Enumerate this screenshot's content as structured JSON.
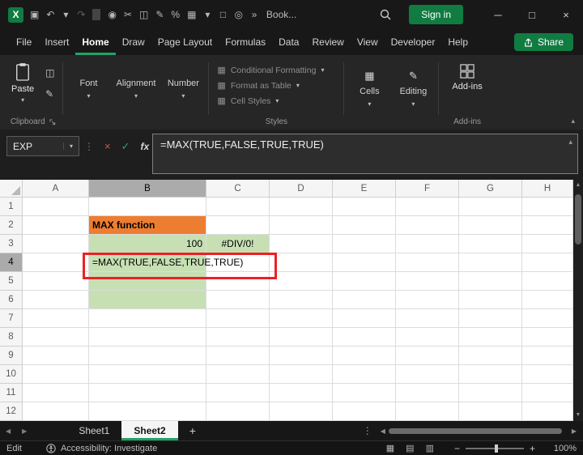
{
  "colors": {
    "excel-green": "#107C41",
    "accent-green": "#21A366",
    "cell-orange": "#ED7D31",
    "cell-green": "#C6E0B4",
    "annotation-red": "#ED2024"
  },
  "icons": {
    "caret": "▾",
    "collapse": "▴",
    "expand": "▴",
    "minimize": "─",
    "maximize": "□",
    "close": "×",
    "copy": "◫",
    "format_painter": "✎",
    "cells": "▦",
    "editing": "✎",
    "dots": "⋮",
    "cancel": "×",
    "check": "✓",
    "tri_up": "▲",
    "tri_down": "▼",
    "tri_left": "◀",
    "tri_right": "▶",
    "plus": "+",
    "minus": "−"
  },
  "titlebar": {
    "logo_letter": "X",
    "title": "Book...",
    "sign_in_label": "Sign in",
    "qat_icons": [
      {
        "name": "save",
        "glyph": "▣"
      },
      {
        "name": "undo",
        "glyph": "↶"
      },
      {
        "name": "undo-caret",
        "glyph": "▾"
      },
      {
        "name": "redo",
        "glyph": "↷",
        "dim": true
      },
      {
        "name": "separator",
        "glyph": "",
        "divider": true
      },
      {
        "name": "touch-mode",
        "glyph": "◉"
      },
      {
        "name": "cut",
        "glyph": "✂"
      },
      {
        "name": "copy",
        "glyph": "◫"
      },
      {
        "name": "format-painter",
        "glyph": "✎"
      },
      {
        "name": "percent-style",
        "glyph": "%"
      },
      {
        "name": "borders",
        "glyph": "▦"
      },
      {
        "name": "dropdown-caret",
        "glyph": "▾"
      },
      {
        "name": "new-document",
        "glyph": "□"
      },
      {
        "name": "camera",
        "glyph": "◎"
      },
      {
        "name": "more-commands",
        "glyph": "»"
      }
    ]
  },
  "menu": {
    "items": [
      "File",
      "Insert",
      "Home",
      "Draw",
      "Page Layout",
      "Formulas",
      "Data",
      "Review",
      "View",
      "Developer",
      "Help"
    ],
    "active": "Home",
    "share_label": "Share"
  },
  "ribbon": {
    "paste_label": "Paste",
    "collapsed_groups": [
      "Font",
      "Alignment",
      "Number"
    ],
    "styles_buttons": [
      {
        "label": "Conditional Formatting",
        "glyph": "▦"
      },
      {
        "label": "Format as Table",
        "glyph": "▦"
      },
      {
        "label": "Cell Styles",
        "glyph": "▦"
      }
    ],
    "cells_label": "Cells",
    "editing_label": "Editing",
    "addins_label": "Add-ins",
    "groups": {
      "clipboard": "Clipboard",
      "styles": "Styles",
      "addins": "Add-ins"
    }
  },
  "formula_bar": {
    "name_box": "EXP",
    "fx_label": "fx",
    "formula": "=MAX(TRUE,FALSE,TRUE,TRUE)"
  },
  "grid": {
    "columns": [
      "A",
      "B",
      "C",
      "D",
      "E",
      "F",
      "G",
      "H"
    ],
    "rows": [
      1,
      2,
      3,
      4,
      5,
      6,
      7,
      8,
      9,
      10,
      11,
      12
    ],
    "selected_column": "B",
    "selected_row": 4,
    "cells": {
      "B2": {
        "text": "MAX function",
        "fill": "#ED7D31",
        "bold": true
      },
      "B3": {
        "text": "100",
        "fill": "#C6E0B4",
        "align": "right"
      },
      "C3": {
        "text": "#DIV/0!",
        "fill": "#C6E0B4",
        "align": "center"
      },
      "B4": {
        "text": "=MAX(TRUE,FALSE,TRUE,TRUE)",
        "fill": "#C6E0B4"
      },
      "B5": {
        "fill": "#C6E0B4"
      },
      "B6": {
        "fill": "#C6E0B4"
      }
    }
  },
  "sheet_tabs": {
    "tabs": [
      {
        "label": "Sheet1",
        "active": false
      },
      {
        "label": "Sheet2",
        "active": true
      }
    ]
  },
  "status_bar": {
    "mode": "Edit",
    "accessibility": "Accessibility: Investigate",
    "zoom": "100%",
    "view_icons": [
      {
        "name": "normal-view",
        "glyph": "▦"
      },
      {
        "name": "page-layout-view",
        "glyph": "▤"
      },
      {
        "name": "page-break-view",
        "glyph": "▥"
      }
    ]
  }
}
